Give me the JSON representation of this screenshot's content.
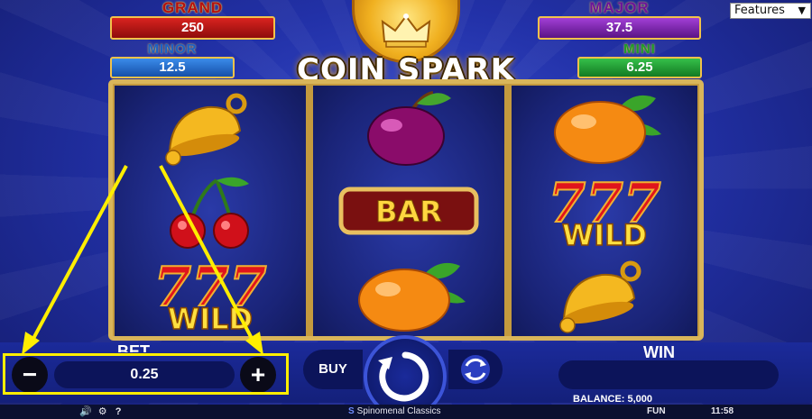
{
  "jackpots": {
    "grand": {
      "label": "GRAND",
      "value": "250"
    },
    "major": {
      "label": "MAJOR",
      "value": "37.5"
    },
    "minor": {
      "label": "MINOR",
      "value": "12.5"
    },
    "mini": {
      "label": "MINI",
      "value": "6.25"
    }
  },
  "logo": {
    "text": "COIN SPARK"
  },
  "features_dropdown": {
    "selected": "Features"
  },
  "reels": [
    [
      "bell",
      "cherries",
      "seven-wild"
    ],
    [
      "plum",
      "bar",
      "orange"
    ],
    [
      "orange",
      "seven-wild",
      "bell"
    ]
  ],
  "symbol_text": {
    "bar": "BAR",
    "wild": "WILD",
    "seven": "777"
  },
  "controls": {
    "bet_label": "BET",
    "bet_value": "0.25",
    "minus_label": "−",
    "plus_label": "+",
    "buy_label": "BUY",
    "win_label": "WIN",
    "win_value": ""
  },
  "status": {
    "balance": "BALANCE: 5,000"
  },
  "footer": {
    "brand": "Spinomenal Classics",
    "mode": "FUN",
    "time": "11:58",
    "help": "?"
  },
  "colors": {
    "annotation": "#ffee00",
    "gold": "#d9b55a",
    "background": "#2231a8"
  }
}
